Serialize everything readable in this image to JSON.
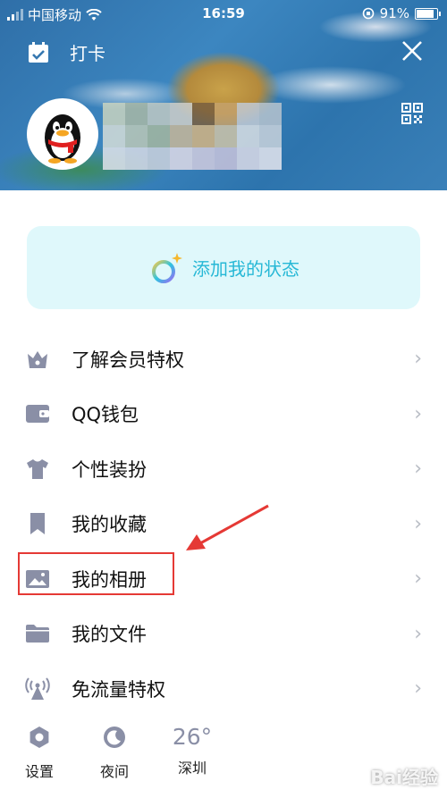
{
  "status_bar": {
    "carrier": "中国移动",
    "time": "16:59",
    "battery": "91%"
  },
  "header": {
    "checkin_label": "打卡"
  },
  "status_card": {
    "label": "添加我的状态"
  },
  "menu": {
    "items": [
      {
        "label": "了解会员特权",
        "icon": "vip-crown-icon"
      },
      {
        "label": "QQ钱包",
        "icon": "wallet-icon"
      },
      {
        "label": "个性装扮",
        "icon": "tshirt-icon"
      },
      {
        "label": "我的收藏",
        "icon": "bookmark-icon"
      },
      {
        "label": "我的相册",
        "icon": "photo-album-icon"
      },
      {
        "label": "我的文件",
        "icon": "folder-icon"
      },
      {
        "label": "免流量特权",
        "icon": "signal-tower-icon"
      }
    ]
  },
  "bottom_bar": {
    "settings": "设置",
    "night": "夜间",
    "temperature": "26°",
    "city": "深圳"
  },
  "watermark": "Bai经验",
  "colors": {
    "accent": "#27b8d6",
    "icon": "#8a8fa6",
    "highlight": "#e53935"
  }
}
